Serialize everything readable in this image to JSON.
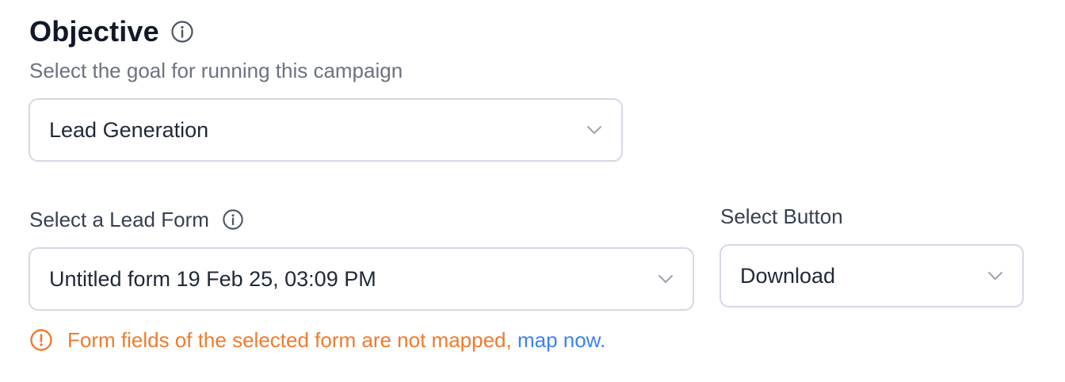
{
  "objective": {
    "title": "Objective",
    "info_icon": "info-icon",
    "subtitle": "Select the goal for running this campaign",
    "selected_value": "Lead Generation",
    "dropdown_icon": "chevron-down-icon"
  },
  "lead_form": {
    "label": "Select a Lead Form",
    "info_icon": "info-icon",
    "selected_value": "Untitled form 19 Feb 25, 03:09 PM",
    "dropdown_icon": "chevron-down-icon"
  },
  "button": {
    "label": "Select Button",
    "selected_value": "Download",
    "dropdown_icon": "chevron-down-icon"
  },
  "warning": {
    "icon": "warning-circle-icon",
    "message": "Form fields of the selected form are not mapped,",
    "link_text": "map now.",
    "colors": {
      "warning": "#f07a2c",
      "link": "#3b82f6"
    }
  }
}
